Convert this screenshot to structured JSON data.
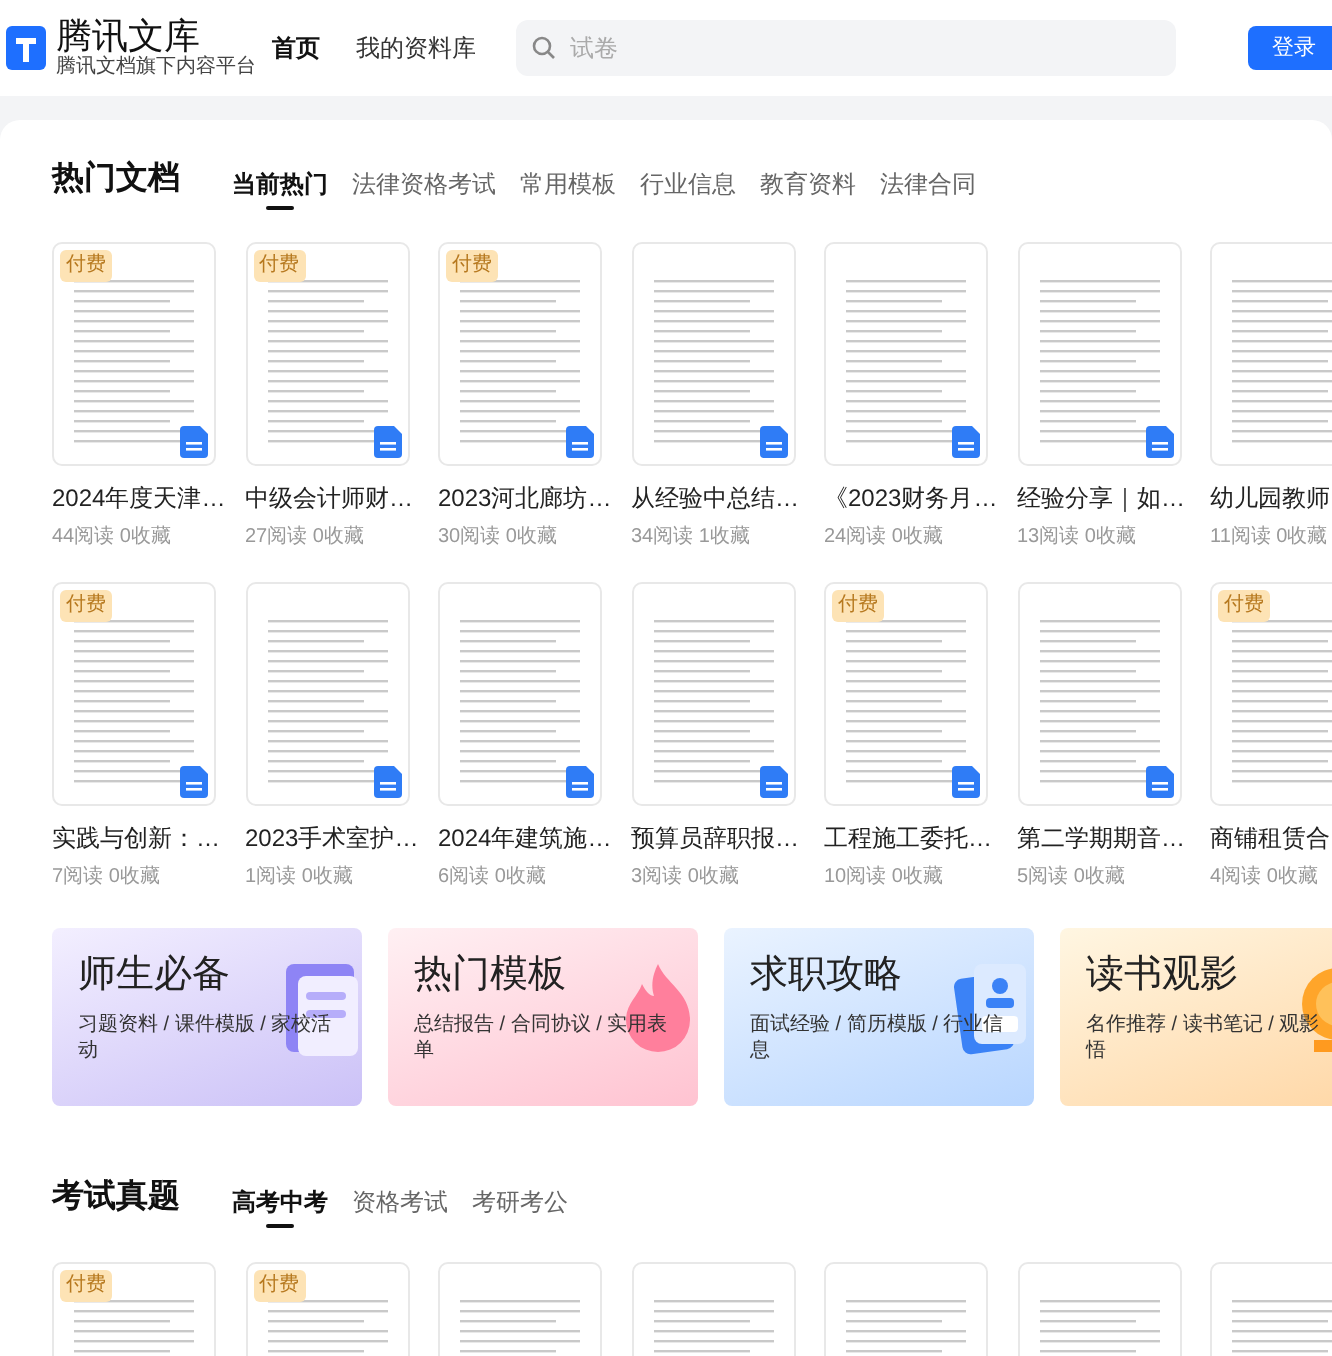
{
  "header": {
    "logo_title": "腾讯文库",
    "logo_subtitle": "腾讯文档旗下内容平台",
    "nav": [
      {
        "label": "首页",
        "selected": true
      },
      {
        "label": "我的资料库",
        "selected": false
      }
    ],
    "search": {
      "placeholder": "试卷"
    },
    "login_button": "登录"
  },
  "hot_docs": {
    "title": "热门文档",
    "tabs": [
      {
        "label": "当前热门",
        "selected": true
      },
      {
        "label": "法律资格考试",
        "selected": false
      },
      {
        "label": "常用模板",
        "selected": false
      },
      {
        "label": "行业信息",
        "selected": false
      },
      {
        "label": "教育资料",
        "selected": false
      },
      {
        "label": "法律合同",
        "selected": false
      }
    ],
    "rows": [
      [
        {
          "title": "2024年度天津…",
          "stats": "44阅读 0收藏",
          "badge": "付费"
        },
        {
          "title": "中级会计师财…",
          "stats": "27阅读 0收藏",
          "badge": "付费"
        },
        {
          "title": "2023河北廊坊…",
          "stats": "30阅读 0收藏",
          "badge": "付费"
        },
        {
          "title": "从经验中总结…",
          "stats": "34阅读 1收藏"
        },
        {
          "title": "《2023财务月…",
          "stats": "24阅读 0收藏"
        },
        {
          "title": "经验分享｜如…",
          "stats": "13阅读 0收藏"
        },
        {
          "title": "幼儿园教师",
          "stats": "11阅读 0收藏"
        }
      ],
      [
        {
          "title": "实践与创新：…",
          "stats": "7阅读 0收藏",
          "badge": "付费"
        },
        {
          "title": "2023手术室护…",
          "stats": "1阅读 0收藏"
        },
        {
          "title": "2024年建筑施…",
          "stats": "6阅读 0收藏"
        },
        {
          "title": "预算员辞职报…",
          "stats": "3阅读 0收藏"
        },
        {
          "title": "工程施工委托…",
          "stats": "10阅读 0收藏",
          "badge": "付费"
        },
        {
          "title": "第二学期期音…",
          "stats": "5阅读 0收藏"
        },
        {
          "title": "商铺租赁合",
          "stats": "4阅读 0收藏",
          "badge": "付费"
        }
      ]
    ]
  },
  "banners": [
    {
      "kind": "teacher",
      "title": "师生必备",
      "subtitle_lines": [
        "习题资料 / 课件模版 / 家校活",
        "动"
      ]
    },
    {
      "kind": "template",
      "title": "热门模板",
      "subtitle_lines": [
        "总结报告 / 合同协议 / 实用表",
        "单"
      ]
    },
    {
      "kind": "job",
      "title": "求职攻略",
      "subtitle_lines": [
        "面试经验 / 简历模版 / 行业信",
        "息"
      ]
    },
    {
      "kind": "reading",
      "title": "读书观影",
      "subtitle_lines": [
        "名作推荐 / 读书笔记 / 观影",
        "悟"
      ]
    }
  ],
  "exams": {
    "title": "考试真题",
    "tabs": [
      {
        "label": "高考中考",
        "selected": true
      },
      {
        "label": "资格考试",
        "selected": false
      },
      {
        "label": "考研考公",
        "selected": false
      }
    ],
    "cards": [
      {
        "kind": "document",
        "badge": "付费"
      },
      {
        "kind": "document",
        "badge": "付费"
      },
      {
        "kind": "document"
      },
      {
        "kind": "document"
      },
      {
        "kind": "document"
      },
      {
        "kind": "document"
      },
      {
        "kind": "document"
      }
    ]
  }
}
